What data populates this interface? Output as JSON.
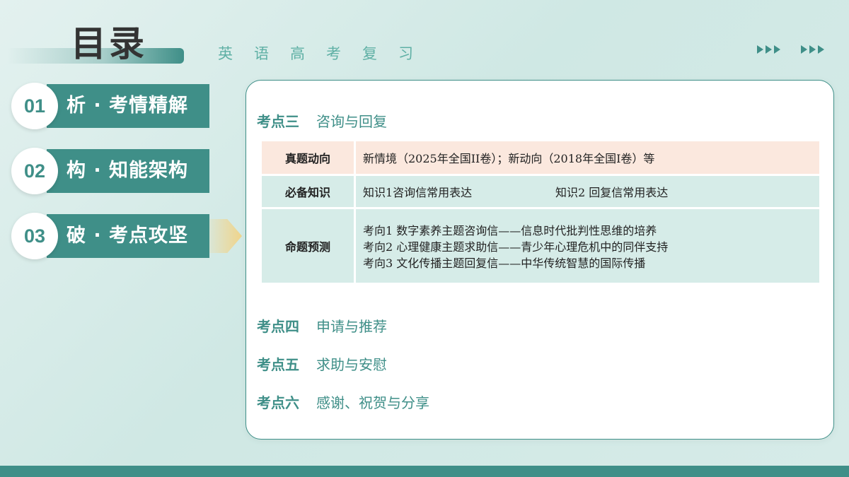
{
  "header": {
    "title": "目录",
    "subtitle": "英语高考复习"
  },
  "nav": [
    {
      "num": "01",
      "label": "析 · 考情精解"
    },
    {
      "num": "02",
      "label": "构 · 知能架构"
    },
    {
      "num": "03",
      "label": "破 · 考点攻坚"
    }
  ],
  "active_nav": "03",
  "card": {
    "point3": {
      "num": "考点三",
      "title": "咨询与回复"
    },
    "table": {
      "row1": {
        "head": "真题动向",
        "content": "新情境（2025年全国II卷）；新动向（2018年全国I卷）等"
      },
      "row2": {
        "head": "必备知识",
        "k1": "知识1咨询信常用表达",
        "k2": "知识2  回复信常用表达"
      },
      "row3": {
        "head": "命题预测",
        "lines": [
          "考向1  数字素养主题咨询信——信息时代批判性思维的培养",
          "考向2  心理健康主题求助信——青少年心理危机中的同伴支持",
          "考向3  文化传播主题回复信——中华传统智慧的国际传播"
        ]
      }
    },
    "points": [
      {
        "num": "考点四",
        "title": "申请与推荐"
      },
      {
        "num": "考点五",
        "title": "求助与安慰"
      },
      {
        "num": "考点六",
        "title": "感谢、祝贺与分享"
      }
    ]
  },
  "colors": {
    "accent": "#3f8f88",
    "highlight": "#f0d48a",
    "row_pink": "#fbe8de",
    "row_teal": "#d6ece8"
  },
  "icons": [
    "triple-chevron-right-icon",
    "triple-chevron-right-icon",
    "active-pointer-arrow-icon"
  ]
}
